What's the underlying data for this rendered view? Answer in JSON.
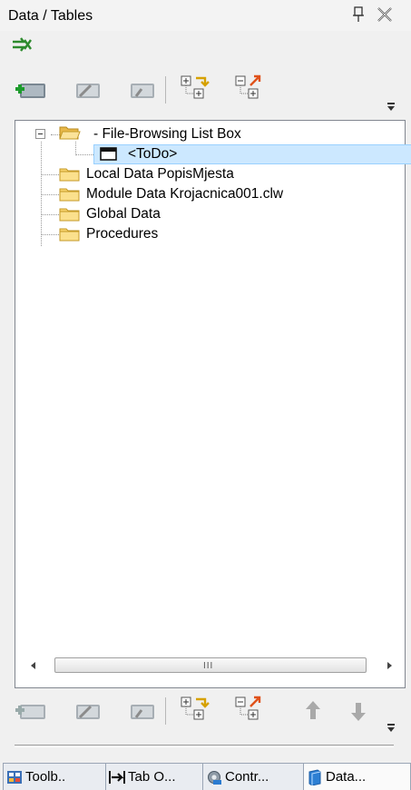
{
  "window": {
    "title": "Data / Tables"
  },
  "toolbar_top": {
    "buttons": [
      "add-item-icon",
      "edit-item-icon",
      "delete-item-icon",
      "expand-all-icon",
      "collapse-all-icon"
    ]
  },
  "tree": {
    "root": {
      "label": "- File-Browsing List Box",
      "expanded": true
    },
    "child": {
      "label": "<ToDo>"
    },
    "nodes": [
      {
        "label": "Local Data PopisMjesta"
      },
      {
        "label": "Module Data Krojacnica001.clw"
      },
      {
        "label": "Global Data"
      },
      {
        "label": "Procedures"
      }
    ]
  },
  "scrollbar": {
    "grip": "III"
  },
  "toolbar_bottom": {
    "buttons": [
      "add-item-icon",
      "edit-item-icon",
      "delete-item-icon",
      "expand-all-icon",
      "collapse-all-icon",
      "move-up-icon",
      "move-down-icon"
    ]
  },
  "tabs": [
    {
      "label": "Toolb..",
      "active": false
    },
    {
      "label": "Tab O...",
      "active": false
    },
    {
      "label": "Contr...",
      "active": false
    },
    {
      "label": "Data...",
      "active": true
    }
  ],
  "colors": {
    "selection": "#cce8ff",
    "folder": "#f7d36b",
    "accent": "#2e8b2e"
  }
}
